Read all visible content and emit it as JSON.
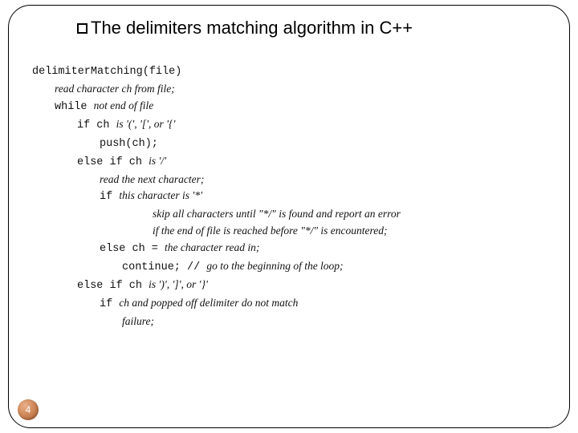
{
  "title": "The delimiters matching algorithm in C++",
  "page_number": "4",
  "code": {
    "l0_mono": "delimiterMatching(file)",
    "l1_ital": "read character ch  from  file;",
    "l2_mono": "while ",
    "l2_ital": " not end of file",
    "l3_mono": "if ch ",
    "l3_ital": " is '(', '[', or '{'",
    "l4_mono": "push(ch);",
    "l5_mono": "else if ch ",
    "l5_ital": " is '/'",
    "l6_ital": "read the next character;",
    "l7_mono": "if ",
    "l7_ital": " this character is '*'",
    "l8_ital": "skip all characters until \"*/\" is found and report an error",
    "l8b_ital": "if the end of file is reached before \"*/\" is encountered;",
    "l9_mono": "else ch = ",
    "l9_ital": " the character read in;",
    "l10_mono": "continue;  // ",
    "l10_ital": " go to the beginning of the loop;",
    "l11_mono": "else if ch ",
    "l11_ital": " is ')', ']', or '}'",
    "l12_mono": "if ",
    "l12_ital": "ch  and popped off delimiter do not match",
    "l13_ital": "failure;"
  }
}
